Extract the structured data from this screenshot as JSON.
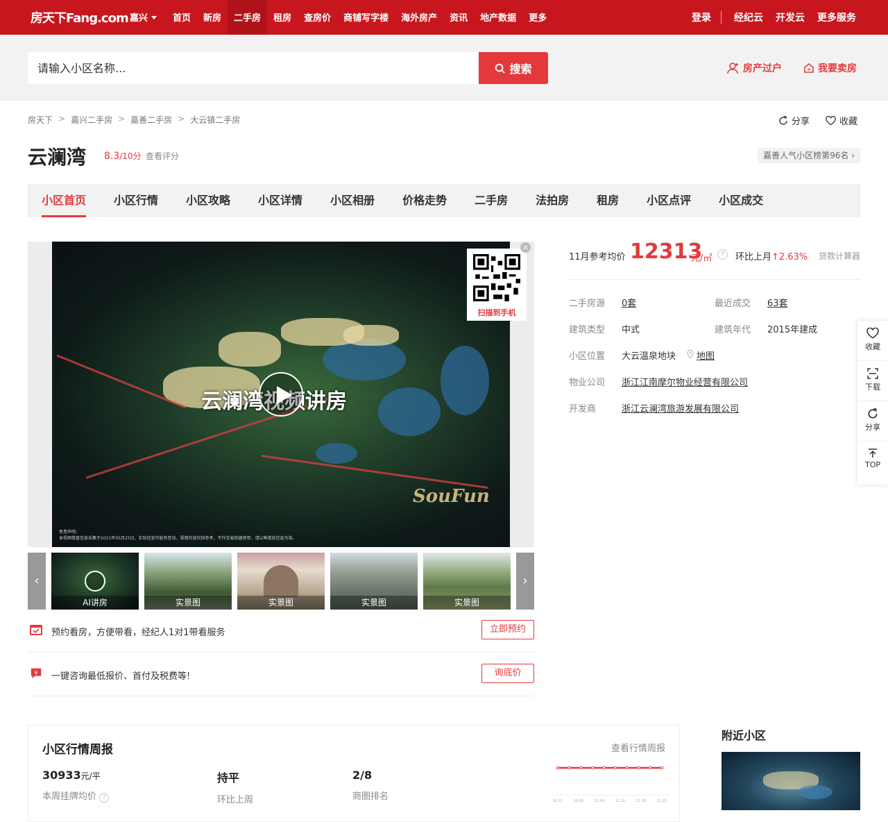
{
  "header": {
    "logo": "房天下Fang.com",
    "city": "嘉兴",
    "nav": [
      "首页",
      "新房",
      "二手房",
      "租房",
      "查房价",
      "商铺写字楼",
      "海外房产",
      "资讯",
      "地产数据",
      "更多"
    ],
    "active_nav": "二手房",
    "right_links": [
      "登录",
      "经纪云",
      "开发云",
      "更多服务"
    ]
  },
  "search": {
    "placeholder": "请输入小区名称...",
    "button": "搜索",
    "link_transfer": "房产过户",
    "link_sell": "我要卖房"
  },
  "breadcrumb": [
    "房天下",
    "嘉兴二手房",
    "嘉善二手房",
    "大云镇二手房"
  ],
  "tools": {
    "share": "分享",
    "favorite": "收藏"
  },
  "community": {
    "name": "云澜湾",
    "score": "8.3",
    "score_suffix": "/10分",
    "see_score": "查看评分",
    "rank": "嘉善人气小区榜第96名 ›"
  },
  "tabs": [
    "小区首页",
    "小区行情",
    "小区攻略",
    "小区详情",
    "小区相册",
    "价格走势",
    "二手房",
    "法拍房",
    "租房",
    "小区点评",
    "小区成交"
  ],
  "gallery": {
    "video_title": "云澜湾视频讲房",
    "disclaimer_1": "免责声明:",
    "disclaimer_2": "本视频楼盘信息采集于2021年05月25日，实际信息可能有变动，视频内容仅供参考，不作交易依据使用，请以售楼处信息为准。",
    "watermark": "SouFun",
    "qr_text": "扫描到手机",
    "close": "×",
    "prev": "‹",
    "next": "›",
    "thumbs": [
      {
        "label": "AI讲房",
        "kind": "video"
      },
      {
        "label": "实景图",
        "kind": "garden"
      },
      {
        "label": "实景图",
        "kind": "building"
      },
      {
        "label": "实景图",
        "kind": "rock"
      },
      {
        "label": "实景图",
        "kind": "pond"
      }
    ]
  },
  "service_rows": [
    {
      "text": "预约看房，方便带看，经纪人1对1带看服务",
      "button": "立即预约",
      "icon": "calendar-icon"
    },
    {
      "text": "一键咨询最低报价、首付及税费等!",
      "button": "询底价",
      "icon": "price-tag-icon"
    }
  ],
  "price": {
    "label": "11月参考均价",
    "value": "12313",
    "unit": "元/㎡",
    "help": "?",
    "change_label": "环比上月",
    "change_value": "↑2.63%",
    "calculator": "贷款计算器"
  },
  "info": {
    "listings_label": "二手房源",
    "listings_value": "0套",
    "deals_label": "最近成交",
    "deals_value": "63套",
    "type_label": "建筑类型",
    "type_value": "中式",
    "year_label": "建筑年代",
    "year_value": "2015年建成",
    "location_label": "小区位置",
    "location_value": "大云温泉地块",
    "map_link": "地图",
    "property_label": "物业公司",
    "property_value": "浙江江南摩尔物业经营有限公司",
    "developer_label": "开发商",
    "developer_value": "浙江云澜湾旅游发展有限公司"
  },
  "side_tools": [
    "收藏",
    "下载",
    "分享",
    "TOP"
  ],
  "weekly": {
    "title": "小区行情周报",
    "link": "查看行情周报",
    "avg_value": "30933",
    "avg_unit": "元/平",
    "avg_label": "本周挂牌均价",
    "trend_value": "持平",
    "trend_label": "环比上周",
    "rank_value": "2/8",
    "rank_label": "商圈排名",
    "chart_dates": [
      "10.21",
      "10.28",
      "11.04",
      "11.11",
      "11.18",
      "11.25"
    ]
  },
  "nearby": {
    "title": "附近小区"
  },
  "colors": {
    "brand_red": "#c8161e",
    "accent_red": "#e4393c"
  }
}
